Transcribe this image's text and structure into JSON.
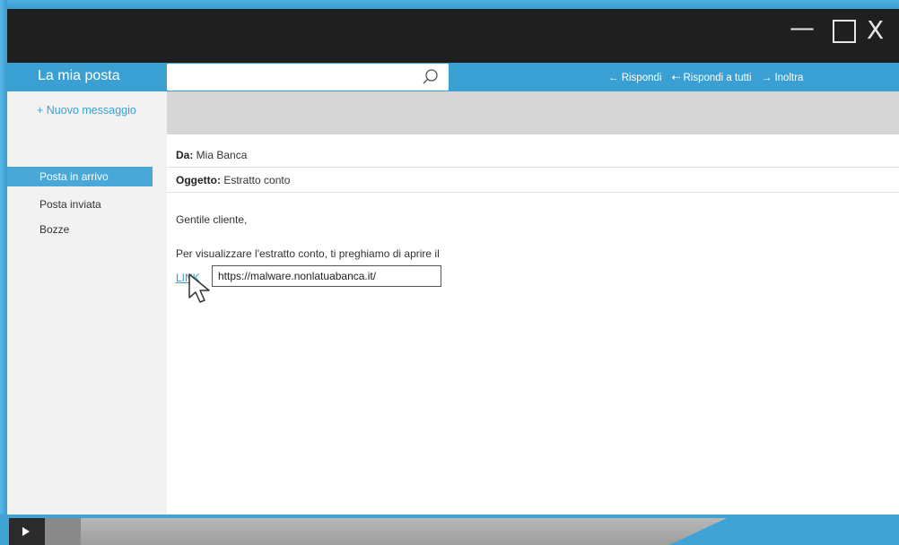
{
  "window": {
    "controls": {
      "minimize": "—",
      "close": "X"
    }
  },
  "app": {
    "title": "La mia posta"
  },
  "search": {
    "placeholder": "",
    "icon": "search-icon"
  },
  "actions": {
    "reply": "← Rispondi",
    "reply_all": "⇠ Rispondi a tutti",
    "forward": "→ Inoltra"
  },
  "sidebar": {
    "new_message": "+ Nuovo messaggio",
    "items": [
      {
        "label": "Posta in arrivo",
        "active": true
      },
      {
        "label": "Posta inviata",
        "active": false
      },
      {
        "label": "Bozze",
        "active": false
      }
    ]
  },
  "message": {
    "from_label": "Da:",
    "from_value": " Mia Banca",
    "subject_label": "Oggetto:",
    "subject_value": " Estratto conto",
    "greeting": "Gentile cliente,",
    "body": "Per visualizzare l'estratto conto, ti preghiamo di aprire il",
    "link_text": "LINK",
    "link_tooltip": "https://malware.nonlatuabanca.it/"
  },
  "colors": {
    "accent": "#3aa0d3",
    "titlebar": "#1f1f20",
    "sidebar": "#f2f2f2"
  }
}
